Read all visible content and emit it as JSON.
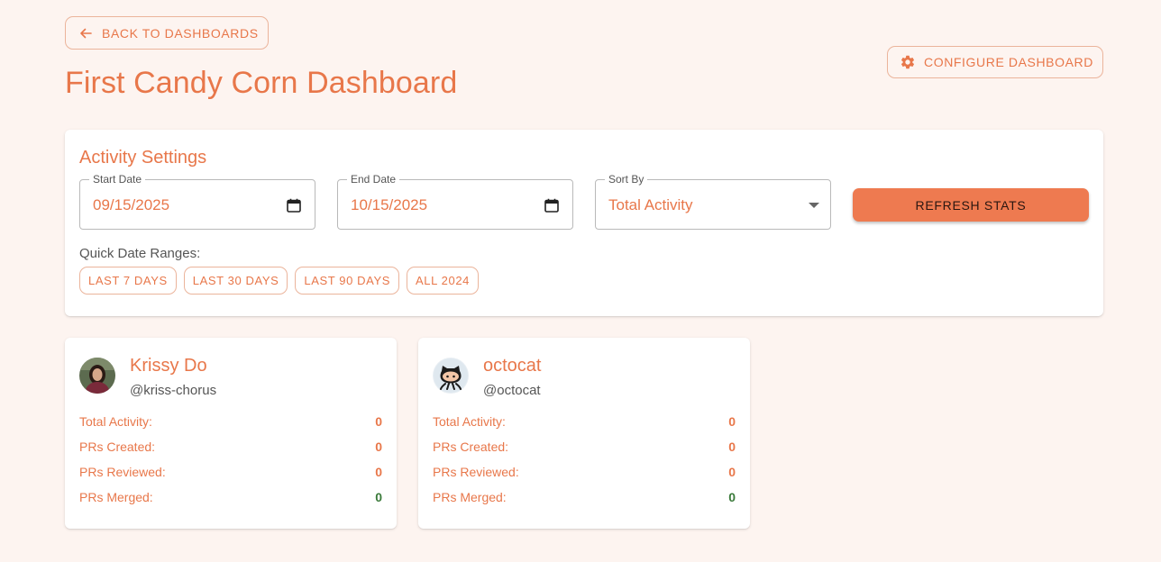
{
  "header": {
    "back_label": "BACK TO DASHBOARDS",
    "title": "First Candy Corn Dashboard",
    "configure_label": "CONFIGURE DASHBOARD"
  },
  "settings": {
    "title": "Activity Settings",
    "start_date": {
      "label": "Start Date",
      "value": "09/15/2025"
    },
    "end_date": {
      "label": "End Date",
      "value": "10/15/2025"
    },
    "sort_by": {
      "label": "Sort By",
      "value": "Total Activity"
    },
    "refresh_label": "REFRESH STATS",
    "quick_label": "Quick Date Ranges:",
    "quick_ranges": [
      "LAST 7 DAYS",
      "LAST 30 DAYS",
      "LAST 90 DAYS",
      "ALL 2024"
    ]
  },
  "users": [
    {
      "name": "Krissy Do",
      "handle": "@kriss-chorus",
      "stats": [
        {
          "label": "Total Activity:",
          "value": "0"
        },
        {
          "label": "PRs Created:",
          "value": "0"
        },
        {
          "label": "PRs Reviewed:",
          "value": "0"
        },
        {
          "label": "PRs Merged:",
          "value": "0"
        }
      ]
    },
    {
      "name": "octocat",
      "handle": "@octocat",
      "stats": [
        {
          "label": "Total Activity:",
          "value": "0"
        },
        {
          "label": "PRs Created:",
          "value": "0"
        },
        {
          "label": "PRs Reviewed:",
          "value": "0"
        },
        {
          "label": "PRs Merged:",
          "value": "0"
        }
      ]
    }
  ],
  "colors": {
    "background": "#fdf4f0",
    "accent": "#e8774a",
    "button_fill": "#ee7a50",
    "merged_value": "#3a7a3a"
  }
}
